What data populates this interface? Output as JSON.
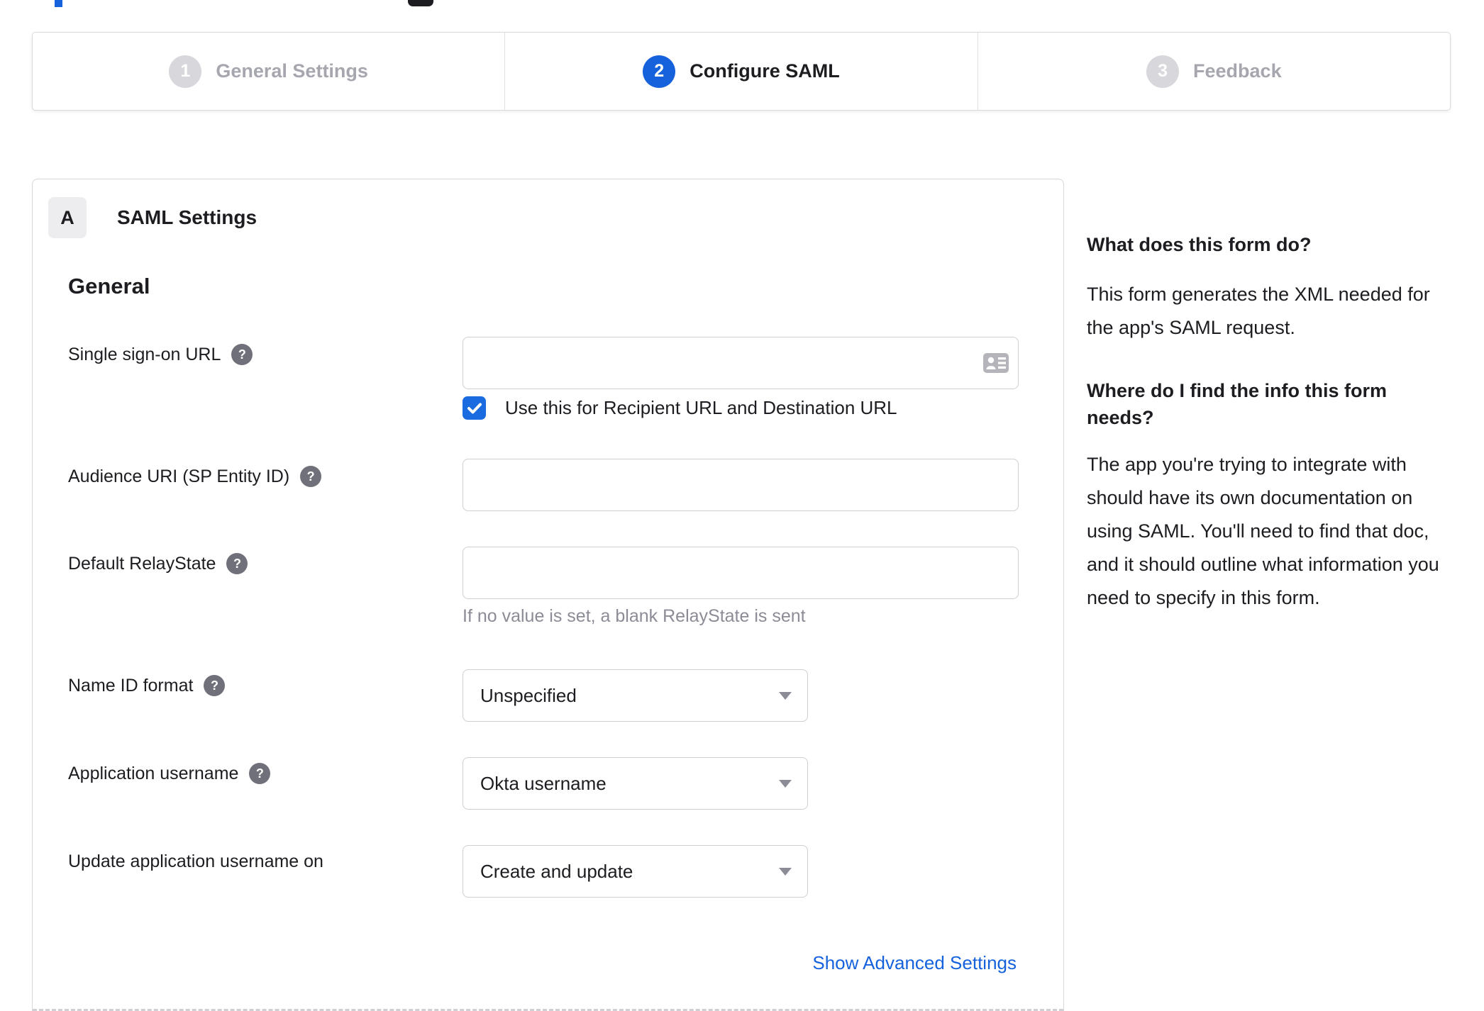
{
  "colors": {
    "accent_blue": "#1662dd",
    "checkbox_blue": "#1a6be0",
    "text_dark": "#1d1d21",
    "text_gray": "#8c8c96",
    "border_gray": "#d7d7dc"
  },
  "wizard": {
    "steps": [
      {
        "number": "1",
        "label": "General Settings",
        "active": false
      },
      {
        "number": "2",
        "label": "Configure SAML",
        "active": true
      },
      {
        "number": "3",
        "label": "Feedback",
        "active": false
      }
    ]
  },
  "panel": {
    "badge": "A",
    "title": "SAML Settings",
    "section": "General",
    "sso": {
      "label": "Single sign-on URL",
      "value": "",
      "checkbox_label": "Use this for Recipient URL and Destination URL",
      "checkbox_checked": true
    },
    "audience": {
      "label": "Audience URI (SP Entity ID)",
      "value": ""
    },
    "relay": {
      "label": "Default RelayState",
      "value": "",
      "hint": "If no value is set, a blank RelayState is sent"
    },
    "name_id": {
      "label": "Name ID format",
      "value": "Unspecified"
    },
    "app_username": {
      "label": "Application username",
      "value": "Okta username"
    },
    "update_username": {
      "label": "Update application username on",
      "value": "Create and update"
    },
    "advanced_link": "Show Advanced Settings"
  },
  "sidebar": {
    "q1": "What does this form do?",
    "a1": "This form generates the XML needed for the app's SAML request.",
    "q2": "Where do I find the info this form needs?",
    "a2": "The app you're trying to integrate with should have its own documentation on using SAML. You'll need to find that doc, and it should outline what information you need to specify in this form."
  }
}
